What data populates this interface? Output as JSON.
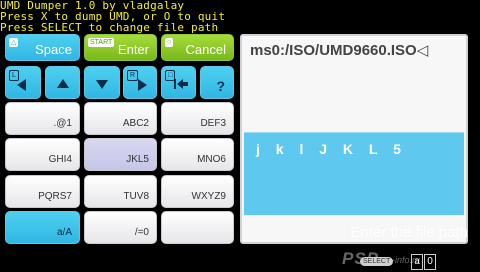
{
  "header": {
    "line1": "UMD Dumper 1.0 by vladgalay",
    "line2": "Press X to dump UMD, or O to quit",
    "line3": "Press SELECT to change file path"
  },
  "keyboard": {
    "space": {
      "label": "Space",
      "tag": "△"
    },
    "enter": {
      "label": "Enter",
      "tag": "START"
    },
    "cancel": {
      "label": "Cancel",
      "tag": "○"
    },
    "nav": {
      "l_tag": "L",
      "r_tag": "R",
      "sq_tag": "□",
      "help": "?"
    },
    "keys": [
      ".@1",
      "ABC2",
      "DEF3",
      "GHI4",
      "JKL5",
      "MNO6",
      "PQRS7",
      "TUV8",
      "WXYZ9",
      "a/A",
      "/=0"
    ]
  },
  "panel": {
    "path": "ms0:/ISO/UMD9660.ISO",
    "cursor": "◁",
    "input_text": "j k l J K L 5"
  },
  "hint": "Enter the file path",
  "footer": {
    "brand": "PSP",
    "brand_suffix": "-info.ru",
    "select_label": "SELECT",
    "mini_a": "a",
    "mini_b": "0"
  },
  "colors": {
    "header_text": "#f2ef2a",
    "cyan": "#2fb7e3",
    "green": "#79b81b",
    "input_bg": "#5ec8ef"
  }
}
